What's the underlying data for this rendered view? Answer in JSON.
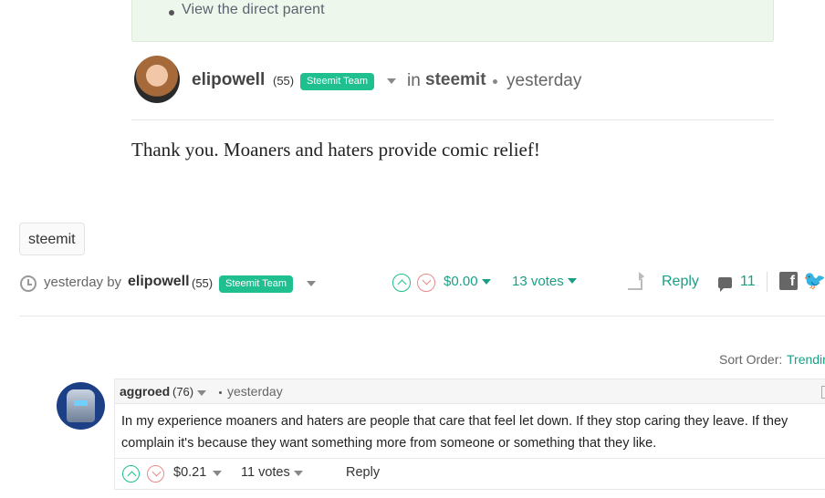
{
  "parent": {
    "link_text": "View the direct parent"
  },
  "post": {
    "author": "elipowell",
    "reputation": "(55)",
    "badge": "Steemit Team",
    "in_label": "in",
    "category": "steemit",
    "time": "yesterday",
    "body": "Thank you. Moaners and haters provide comic relief!"
  },
  "tags": [
    "steemit"
  ],
  "footer": {
    "time": "yesterday",
    "by_label": "by",
    "author": "elipowell",
    "reputation": "(55)",
    "badge": "Steemit Team",
    "payout": "$0.00",
    "votes": "13 votes",
    "reply_label": "Reply",
    "comment_count": "11",
    "facebook_glyph": "f",
    "twitter_glyph": "🐦"
  },
  "sort": {
    "label": "Sort Order:",
    "value": "Trending"
  },
  "comment": {
    "author": "aggroed",
    "reputation": "(76)",
    "separator": "·",
    "time": "yesterday",
    "body": "In my experience moaners and haters are people that care that feel let down. If they stop caring they leave. If they complain it's because they want something more from someone or something that they like.",
    "payout": "$0.21",
    "votes": "11 votes",
    "reply_label": "Reply"
  },
  "colors": {
    "accent": "#1a9f86",
    "badge": "#1fbf8f",
    "parent_bg": "#eef7ec"
  },
  "icons": [
    "clock-icon",
    "upvote-icon",
    "downvote-icon",
    "reblog-icon",
    "comments-icon",
    "facebook-icon",
    "twitter-icon",
    "caret-down-icon"
  ]
}
